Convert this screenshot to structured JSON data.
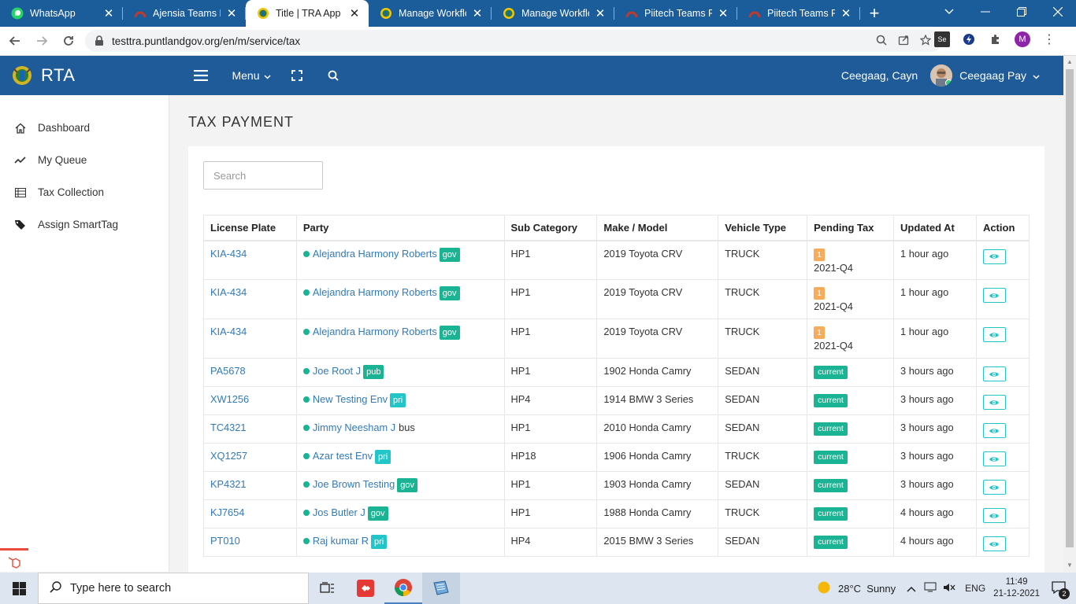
{
  "browser": {
    "tabs": [
      {
        "title": "WhatsApp",
        "icon": "whatsapp-icon",
        "active": false
      },
      {
        "title": "Ajensia Teams Po",
        "icon": "teams-portal-icon",
        "active": false
      },
      {
        "title": "Title | TRA App",
        "icon": "tra-crest-icon",
        "active": true
      },
      {
        "title": "Manage Workflo",
        "icon": "tra-crest-icon",
        "active": false
      },
      {
        "title": "Manage Workflo",
        "icon": "tra-crest-icon",
        "active": false
      },
      {
        "title": "Piitech Teams Po",
        "icon": "teams-portal-icon",
        "active": false
      },
      {
        "title": "Piitech Teams Po",
        "icon": "teams-portal-icon",
        "active": false
      }
    ],
    "url": "testtra.puntlandgov.org/en/m/service/tax",
    "profile_initial": "M"
  },
  "app": {
    "brand": "RTA",
    "menu_label": "Menu",
    "user_name": "Ceegaag, Cayn",
    "account_label": "Ceegaag Pay"
  },
  "sidebar": {
    "items": [
      {
        "label": "Dashboard",
        "icon": "home-icon"
      },
      {
        "label": "My Queue",
        "icon": "trend-line-icon"
      },
      {
        "label": "Tax Collection",
        "icon": "list-icon"
      },
      {
        "label": "Assign SmartTag",
        "icon": "tags-icon"
      }
    ]
  },
  "page": {
    "title": "TAX PAYMENT",
    "search_placeholder": "Search"
  },
  "table": {
    "headers": [
      "License Plate",
      "Party",
      "Sub Category",
      "Make / Model",
      "Vehicle Type",
      "Pending Tax",
      "Updated At",
      "Action"
    ],
    "rows": [
      {
        "plate": "KIA-434",
        "party": "Alejandra Harmony Roberts",
        "tag": "gov",
        "sub": "HP1",
        "model": "2019 Toyota CRV",
        "vtype": "TRUCK",
        "pending_count": "1",
        "pending_period": "2021-Q4",
        "updated": "1 hour ago"
      },
      {
        "plate": "KIA-434",
        "party": "Alejandra Harmony Roberts",
        "tag": "gov",
        "sub": "HP1",
        "model": "2019 Toyota CRV",
        "vtype": "TRUCK",
        "pending_count": "1",
        "pending_period": "2021-Q4",
        "updated": "1 hour ago"
      },
      {
        "plate": "KIA-434",
        "party": "Alejandra Harmony Roberts",
        "tag": "gov",
        "sub": "HP1",
        "model": "2019 Toyota CRV",
        "vtype": "TRUCK",
        "pending_count": "1",
        "pending_period": "2021-Q4",
        "updated": "1 hour ago"
      },
      {
        "plate": "PA5678",
        "party": "Joe Root J",
        "tag": "pub",
        "sub": "HP1",
        "model": "1902 Honda Camry",
        "vtype": "SEDAN",
        "status": "current",
        "updated": "3 hours ago"
      },
      {
        "plate": "XW1256",
        "party": "New Testing Env",
        "tag": "pri",
        "sub": "HP4",
        "model": "1914 BMW 3 Series",
        "vtype": "SEDAN",
        "status": "current",
        "updated": "3 hours ago"
      },
      {
        "plate": "TC4321",
        "party": "Jimmy Neesham J",
        "tag": "bus",
        "sub": "HP1",
        "model": "2010 Honda Camry",
        "vtype": "SEDAN",
        "status": "current",
        "updated": "3 hours ago"
      },
      {
        "plate": "XQ1257",
        "party": "Azar test Env",
        "tag": "pri",
        "sub": "HP18",
        "model": "1906 Honda Camry",
        "vtype": "TRUCK",
        "status": "current",
        "updated": "3 hours ago"
      },
      {
        "plate": "KP4321",
        "party": "Joe Brown Testing",
        "tag": "gov",
        "sub": "HP1",
        "model": "1903 Honda Camry",
        "vtype": "SEDAN",
        "status": "current",
        "updated": "3 hours ago"
      },
      {
        "plate": "KJ7654",
        "party": "Jos Butler J",
        "tag": "gov",
        "sub": "HP1",
        "model": "1988 Honda Camry",
        "vtype": "TRUCK",
        "status": "current",
        "updated": "4 hours ago"
      },
      {
        "plate": "PT010",
        "party": "Raj kumar R",
        "tag": "pri",
        "sub": "HP4",
        "model": "2015 BMW 3 Series",
        "vtype": "SEDAN",
        "status": "current",
        "updated": "4 hours ago"
      }
    ]
  },
  "taskbar": {
    "search_placeholder": "Type here to search",
    "weather": "28°C  Sunny",
    "lang": "ENG",
    "time": "11:49",
    "date": "21-12-2021",
    "notifications": "2"
  },
  "colors": {
    "header": "#1e5b98",
    "tabstrip": "#1b5c9a",
    "link": "#337ab7",
    "status_green": "#1ab394",
    "tag_teal": "#23c6c8",
    "pending_orange": "#f8ac59"
  }
}
